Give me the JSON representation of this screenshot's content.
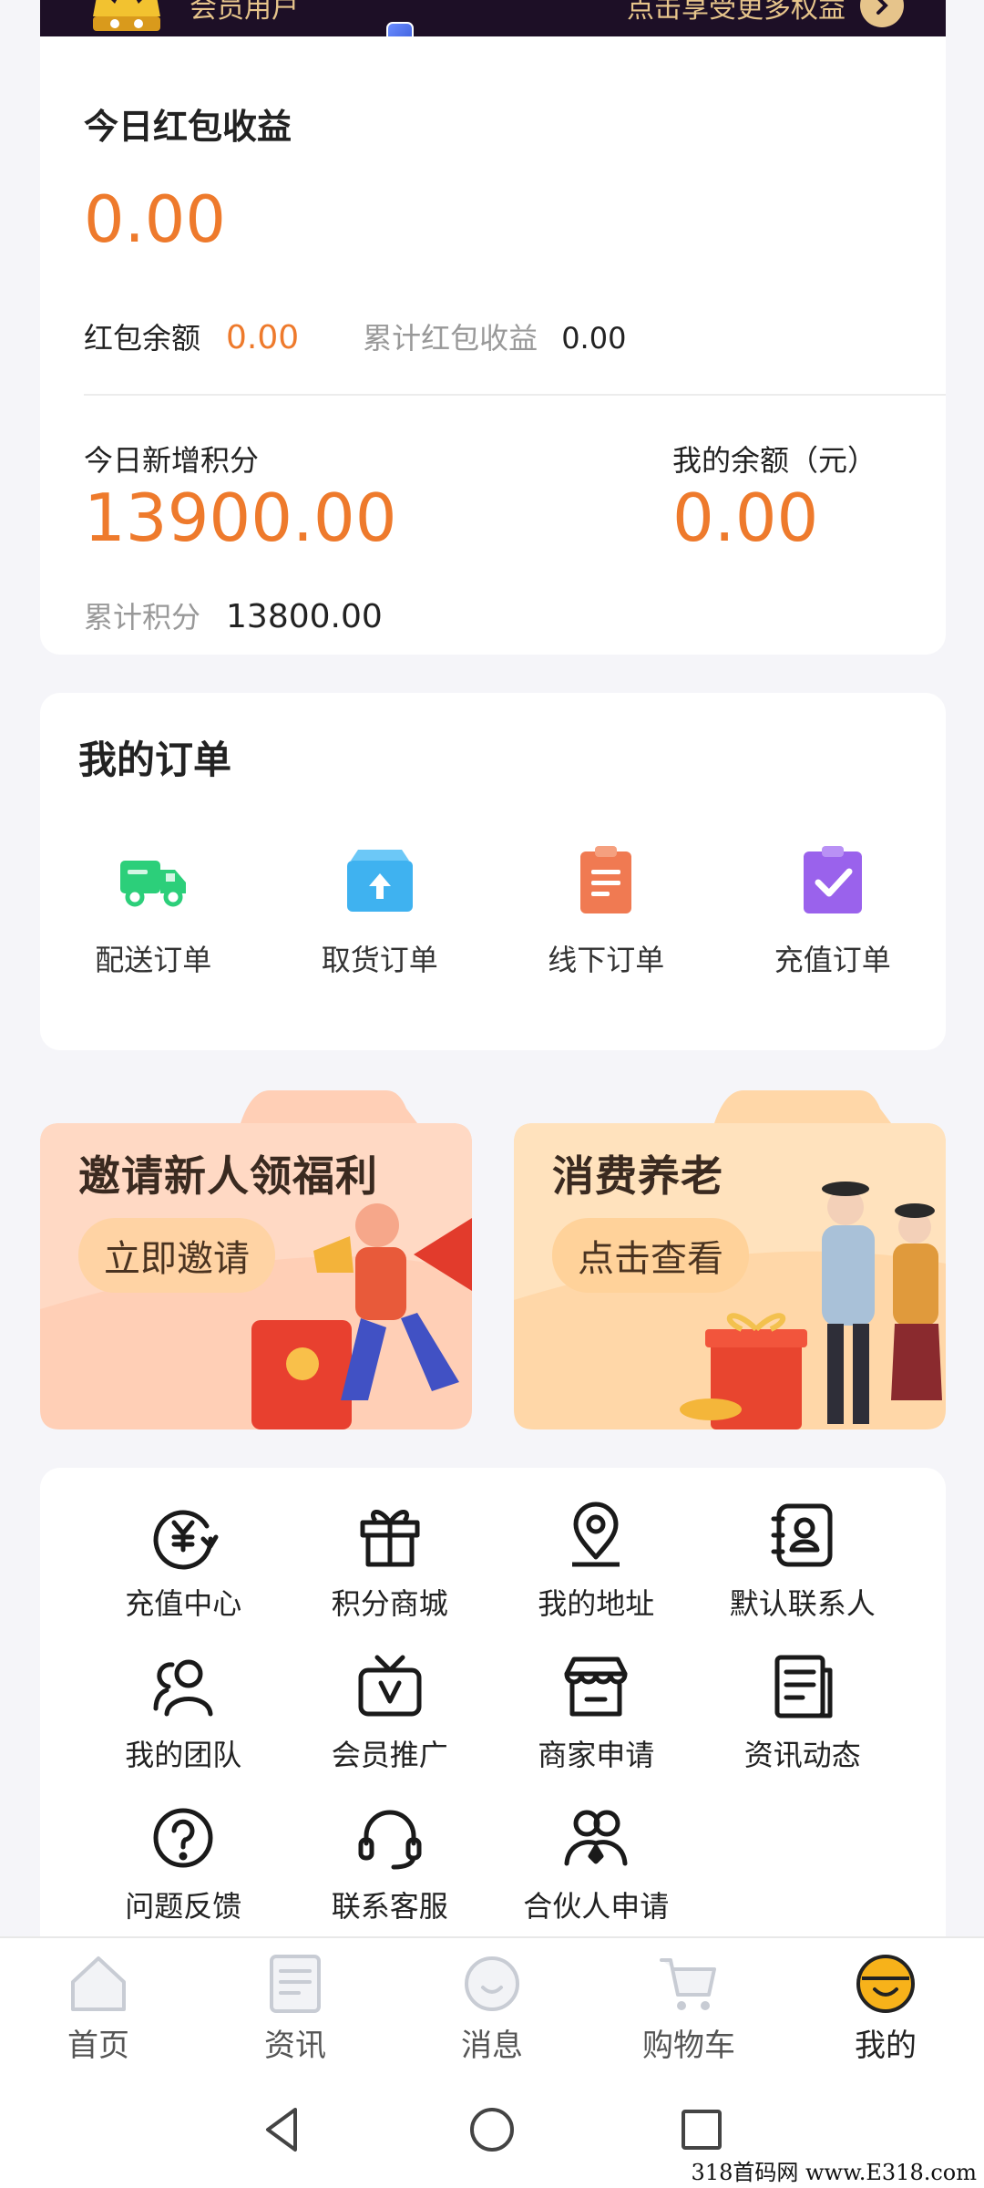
{
  "member": {
    "name": "会员用户",
    "cta": "点击享受更多权益"
  },
  "earnings": {
    "title": "今日红包收益",
    "today_value": "0.00",
    "balance_label": "红包余额",
    "balance_value": "0.00",
    "cumulative_label": "累计红包收益",
    "cumulative_value": "0.00"
  },
  "points": {
    "today_label": "今日新增积分",
    "today_value": "13900.00",
    "my_balance_label": "我的余额（元）",
    "my_balance_value": "0.00",
    "cumulative_label": "累计积分",
    "cumulative_value": "13800.00"
  },
  "orders": {
    "title": "我的订单",
    "items": [
      {
        "label": "配送订单",
        "icon": "truck-icon",
        "color": "#2ccf7a"
      },
      {
        "label": "取货订单",
        "icon": "upload-box-icon",
        "color": "#3fb2f0"
      },
      {
        "label": "线下订单",
        "icon": "clipboard-list-icon",
        "color": "#f07a52"
      },
      {
        "label": "充值订单",
        "icon": "clipboard-check-icon",
        "color": "#9a62ec"
      }
    ]
  },
  "promos": [
    {
      "title": "邀请新人领福利",
      "button": "立即邀请"
    },
    {
      "title": "消费养老",
      "button": "点击查看"
    }
  ],
  "services": [
    {
      "label": "充值中心",
      "icon": "yuan-refresh-icon"
    },
    {
      "label": "积分商城",
      "icon": "gift-icon"
    },
    {
      "label": "我的地址",
      "icon": "location-pin-icon"
    },
    {
      "label": "默认联系人",
      "icon": "contact-book-icon"
    },
    {
      "label": "我的团队",
      "icon": "team-icon"
    },
    {
      "label": "会员推广",
      "icon": "vip-tv-icon"
    },
    {
      "label": "商家申请",
      "icon": "store-icon"
    },
    {
      "label": "资讯动态",
      "icon": "news-document-icon"
    },
    {
      "label": "问题反馈",
      "icon": "question-icon"
    },
    {
      "label": "联系客服",
      "icon": "headset-icon"
    },
    {
      "label": "合伙人申请",
      "icon": "partner-icon"
    }
  ],
  "tabs": [
    {
      "label": "首页",
      "icon": "home-icon",
      "active": false
    },
    {
      "label": "资讯",
      "icon": "news-icon",
      "active": false
    },
    {
      "label": "消息",
      "icon": "message-icon",
      "active": false
    },
    {
      "label": "购物车",
      "icon": "cart-icon",
      "active": false
    },
    {
      "label": "我的",
      "icon": "profile-smile-icon",
      "active": true
    }
  ],
  "colors": {
    "accent_orange": "#ee7a2c",
    "active_tab": "#f7b21a",
    "member_bar": "#1d0f26"
  },
  "watermark": "318首码网 www.E318.com"
}
